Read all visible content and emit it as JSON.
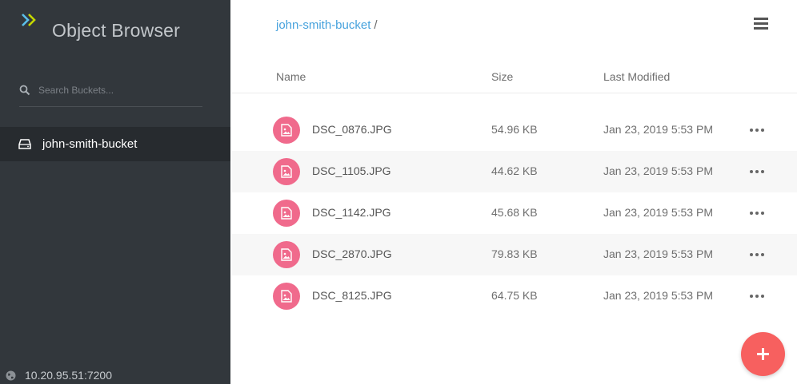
{
  "sidebar": {
    "app_title": "Object Browser",
    "search_placeholder": "Search Buckets...",
    "buckets": [
      {
        "label": "john-smith-bucket",
        "icon": "drive-icon",
        "selected": true
      }
    ],
    "host": "10.20.95.51:7200"
  },
  "header": {
    "breadcrumb": "john-smith-bucket",
    "breadcrumb_separator": "/"
  },
  "table": {
    "columns": {
      "name": "Name",
      "size": "Size",
      "last_modified": "Last Modified"
    },
    "rows": [
      {
        "name": "DSC_0876.JPG",
        "size": "54.96 KB",
        "modified": "Jan 23, 2019 5:53 PM"
      },
      {
        "name": "DSC_1105.JPG",
        "size": "44.62 KB",
        "modified": "Jan 23, 2019 5:53 PM"
      },
      {
        "name": "DSC_1142.JPG",
        "size": "45.68 KB",
        "modified": "Jan 23, 2019 5:53 PM"
      },
      {
        "name": "DSC_2870.JPG",
        "size": "79.83 KB",
        "modified": "Jan 23, 2019 5:53 PM"
      },
      {
        "name": "DSC_8125.JPG",
        "size": "64.75 KB",
        "modified": "Jan 23, 2019 5:53 PM"
      }
    ]
  },
  "colors": {
    "sidebar_bg": "#32373c",
    "selected_bg": "#272b2f",
    "link": "#46a2dd",
    "file_icon": "#f06a8c",
    "fab": "#f7605f"
  }
}
